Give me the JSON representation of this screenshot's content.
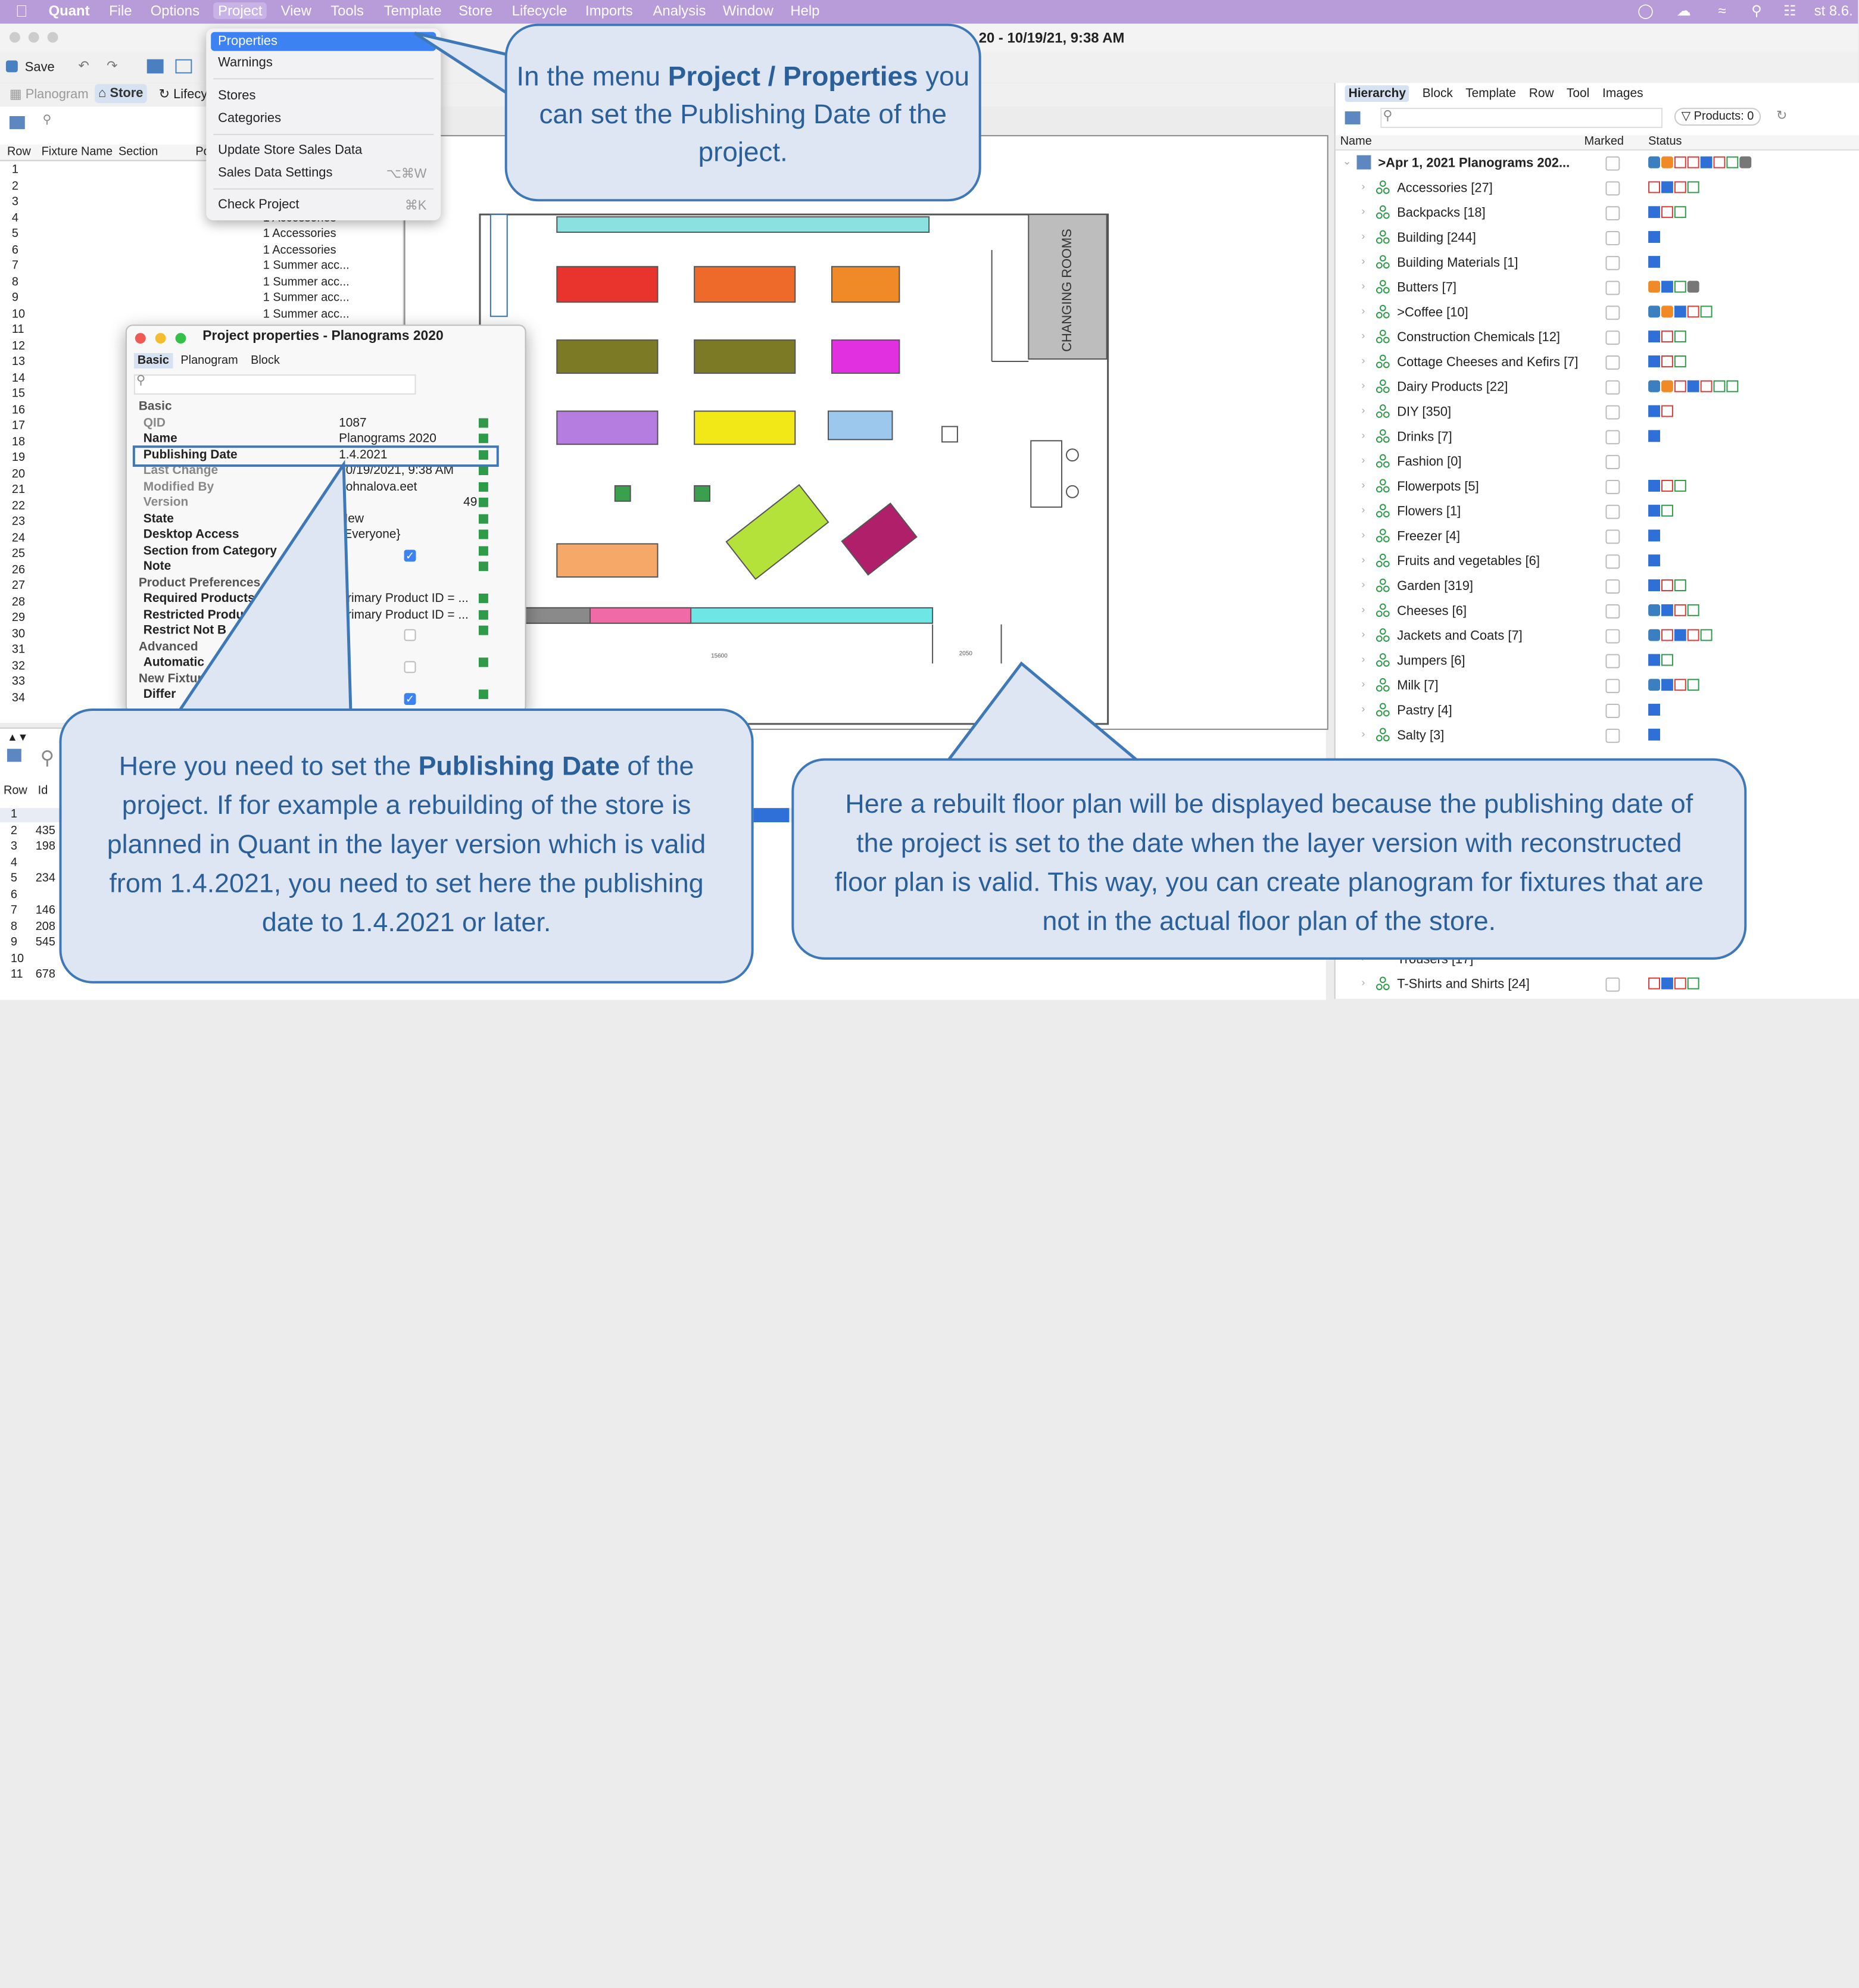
{
  "menubar": {
    "app": "Quant",
    "items": [
      "File",
      "Options",
      "Project",
      "View",
      "Tools",
      "Template",
      "Store",
      "Lifecycle",
      "Imports",
      "Analysis",
      "Window",
      "Help"
    ],
    "right_text": "st 8.6."
  },
  "window": {
    "title_fragment": "20 - 10/19/21, 9:38 AM"
  },
  "toolbar": {
    "save_label": "Save"
  },
  "viewbar": {
    "planogram_tab": "Planogram",
    "store_tab": "Store",
    "lifecycle_tab": "Lifecy"
  },
  "dropdown": {
    "items": [
      {
        "label": "Properties",
        "shortcut": ""
      },
      {
        "label": "Warnings",
        "shortcut": ""
      },
      {
        "label": "Stores",
        "shortcut": ""
      },
      {
        "label": "Categories",
        "shortcut": ""
      },
      {
        "label": "Update Store Sales Data",
        "shortcut": ""
      },
      {
        "label": "Sales Data Settings",
        "shortcut": "⌥⌘W"
      },
      {
        "label": "Check Project",
        "shortcut": "⌘K"
      }
    ]
  },
  "leftgrid": {
    "headers": [
      "Row",
      "Fixture Name",
      "Section",
      "Po"
    ],
    "rows": [
      {
        "n": "1",
        "c": ""
      },
      {
        "n": "2",
        "c": ""
      },
      {
        "n": "3",
        "c": ""
      },
      {
        "n": "4",
        "c": "1 Accessories"
      },
      {
        "n": "5",
        "c": "1 Accessories"
      },
      {
        "n": "6",
        "c": "1 Accessories"
      },
      {
        "n": "7",
        "c": "1 Summer acc..."
      },
      {
        "n": "8",
        "c": "1 Summer acc..."
      },
      {
        "n": "9",
        "c": "1 Summer acc..."
      },
      {
        "n": "10",
        "c": "1 Summer acc..."
      },
      {
        "n": "11",
        "c": ""
      },
      {
        "n": "12",
        "c": ""
      },
      {
        "n": "13",
        "c": ""
      },
      {
        "n": "14",
        "c": ""
      },
      {
        "n": "15",
        "c": ""
      },
      {
        "n": "16",
        "c": ""
      },
      {
        "n": "17",
        "c": ""
      },
      {
        "n": "18",
        "c": ""
      },
      {
        "n": "19",
        "c": ""
      },
      {
        "n": "20",
        "c": ""
      },
      {
        "n": "21",
        "c": ""
      },
      {
        "n": "22",
        "c": ""
      },
      {
        "n": "23",
        "c": ""
      },
      {
        "n": "24",
        "c": ""
      },
      {
        "n": "25",
        "c": ""
      },
      {
        "n": "26",
        "c": ""
      },
      {
        "n": "27",
        "c": ""
      },
      {
        "n": "28",
        "c": ""
      },
      {
        "n": "29",
        "c": ""
      },
      {
        "n": "30",
        "c": ""
      },
      {
        "n": "31",
        "c": ""
      },
      {
        "n": "32",
        "c": ""
      },
      {
        "n": "33",
        "c": ""
      },
      {
        "n": "34",
        "c": ""
      }
    ]
  },
  "lowergrid": {
    "headers": [
      "Row",
      "Id"
    ],
    "rows": [
      {
        "n": "1",
        "id": ""
      },
      {
        "n": "2",
        "id": "435"
      },
      {
        "n": "3",
        "id": "198"
      },
      {
        "n": "4",
        "id": ""
      },
      {
        "n": "5",
        "id": "234"
      },
      {
        "n": "6",
        "id": ""
      },
      {
        "n": "7",
        "id": "146"
      },
      {
        "n": "8",
        "id": "208"
      },
      {
        "n": "9",
        "id": "545"
      },
      {
        "n": "10",
        "id": ""
      },
      {
        "n": "11",
        "id": "678"
      }
    ]
  },
  "dialog": {
    "title": "Project properties - Planograms 2020",
    "tabs": [
      "Basic",
      "Planogram",
      "Block"
    ],
    "rows": [
      {
        "label": "Basic",
        "value": "",
        "type": "section"
      },
      {
        "label": "QID",
        "value": "1087",
        "type": "grey"
      },
      {
        "label": "Name",
        "value": "Planograms 2020",
        "type": "bold"
      },
      {
        "label": "Publishing Date",
        "value": "1.4.2021",
        "type": "bold"
      },
      {
        "label": "Last Change",
        "value": "10/19/2021, 9:38 AM",
        "type": "grey"
      },
      {
        "label": "Modified By",
        "value": "dohnalova.eet",
        "type": "grey"
      },
      {
        "label": "Version",
        "value": "49",
        "type": "grey"
      },
      {
        "label": "State",
        "value": "New",
        "type": "bold"
      },
      {
        "label": "Desktop Access",
        "value": "*Everyone}",
        "type": "bold"
      },
      {
        "label": "Section from Category",
        "value": "",
        "type": "bold"
      },
      {
        "label": "Note",
        "value": "",
        "type": "bold"
      },
      {
        "label": "Product Preferences",
        "value": "",
        "type": "section"
      },
      {
        "label": "Required Products",
        "value": "Primary Product ID = ...",
        "type": "bold"
      },
      {
        "label": "Restricted Products",
        "value": "Primary Product ID = ...",
        "type": "bold"
      },
      {
        "label": "Restrict Not B",
        "value": "",
        "type": "bold"
      },
      {
        "label": "Advanced",
        "value": "",
        "type": "section"
      },
      {
        "label": "Automatic",
        "value": "",
        "type": "bold"
      },
      {
        "label": "New Fixtures",
        "value": "",
        "type": "section"
      },
      {
        "label": "Differ",
        "value": "",
        "type": "bold"
      }
    ]
  },
  "floorplan": {
    "room_label": "CHANGING ROOMS",
    "dim_bottom": "15600",
    "dim_door": "2050"
  },
  "rightpanel": {
    "tabs": [
      "Hierarchy",
      "Block",
      "Template",
      "Row",
      "Tool",
      "Images"
    ],
    "products_label": "Products: 0",
    "col_name": "Name",
    "col_marked": "Marked",
    "col_status": "Status",
    "root": ">Apr 1, 2021 Planograms 202...",
    "items": [
      {
        "name": "Accessories [27]",
        "st": "rbrg"
      },
      {
        "name": "Backpacks [18]",
        "st": "brg"
      },
      {
        "name": "Building [244]",
        "st": "b"
      },
      {
        "name": "Building Materials [1]",
        "st": "b"
      },
      {
        "name": "Butters [7]",
        "st": "obgt"
      },
      {
        "name": ">Coffee [10]",
        "st": "nobrg"
      },
      {
        "name": "Construction Chemicals [12]",
        "st": "brg"
      },
      {
        "name": "Cottage Cheeses and Kefirs [7]",
        "st": "brg"
      },
      {
        "name": "Dairy Products [22]",
        "st": "norbrgg"
      },
      {
        "name": "DIY [350]",
        "st": "br"
      },
      {
        "name": "Drinks [7]",
        "st": "b"
      },
      {
        "name": "Fashion [0]",
        "st": ""
      },
      {
        "name": "Flowerpots [5]",
        "st": "brg"
      },
      {
        "name": "Flowers [1]",
        "st": "bg"
      },
      {
        "name": "Freezer [4]",
        "st": "b"
      },
      {
        "name": "Fruits and vegetables [6]",
        "st": "b"
      },
      {
        "name": "Garden [319]",
        "st": "brg"
      },
      {
        "name": "Cheeses [6]",
        "st": "nbrg"
      },
      {
        "name": "Jackets and Coats [7]",
        "st": "nrbrg"
      },
      {
        "name": "Jumpers [6]",
        "st": "bg"
      },
      {
        "name": "Milk [7]",
        "st": "nbrg"
      },
      {
        "name": "Pastry [4]",
        "st": "b"
      },
      {
        "name": "Salty [3]",
        "st": "b"
      }
    ],
    "bottom_items": [
      {
        "name": "Trousers [17]",
        "st": ""
      },
      {
        "name": "T-Shirts and Shirts [24]",
        "st": "rbrg"
      }
    ]
  },
  "callouts": {
    "top": {
      "pre": "In the menu ",
      "bold": "Project / Properties",
      "post": " you can set the Publishing Date of the project."
    },
    "left": {
      "pre": "Here you need to set the ",
      "bold": "Publishing Date",
      "post": " of the project. If for example a rebuilding of the store is planned in Quant in the layer version which is valid from 1.4.2021, you need to set here the publishing date to 1.4.2021 or later."
    },
    "right": {
      "text": "Here a rebuilt floor plan will be displayed because the publishing date of the project is set to the date when the layer version with reconstructed floor plan is valid. This way, you can create planogram for fixtures that are not in the actual floor plan of the store."
    }
  }
}
